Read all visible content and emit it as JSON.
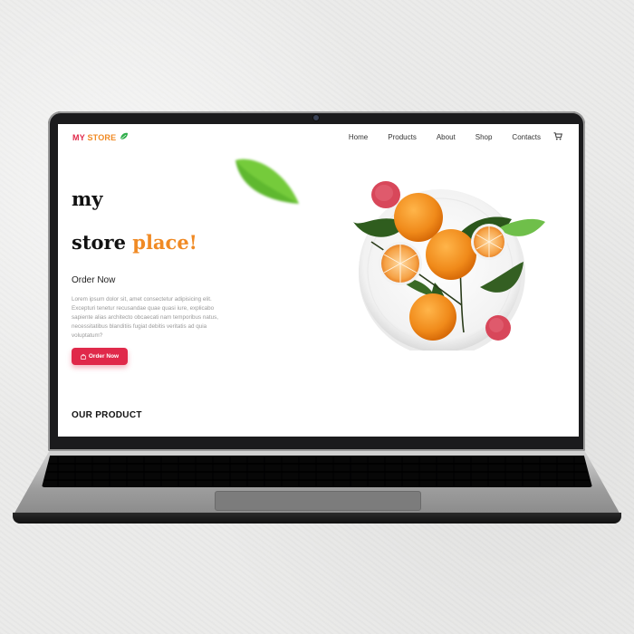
{
  "site": {
    "logo": {
      "part1": "MY",
      "part2": "STORE",
      "leaf_icon": "leaf-icon"
    },
    "nav": [
      "Home",
      "Products",
      "About",
      "Shop",
      "Contacts"
    ],
    "cart_icon": "cart-icon",
    "hero": {
      "line1": "my",
      "line2_prefix": "store ",
      "line2_accent": "place!",
      "order_heading": "Order Now",
      "body": "Lorem ipsum dolor sit, amet consectetur adipisicing elit. Excepturi tenetur recusandae quae quasi iure, explicabo sapiente alias architecto obcaecati nam temporibus natus, necessitatibus blanditiis fugiat debitis veritatis ad quia voluptatum?",
      "cta_label": "Order Now",
      "cta_icon": "bag-icon"
    },
    "section_title": "OUR PRODUCT",
    "colors": {
      "brand_red": "#e0294a",
      "brand_orange": "#f08a24"
    }
  }
}
